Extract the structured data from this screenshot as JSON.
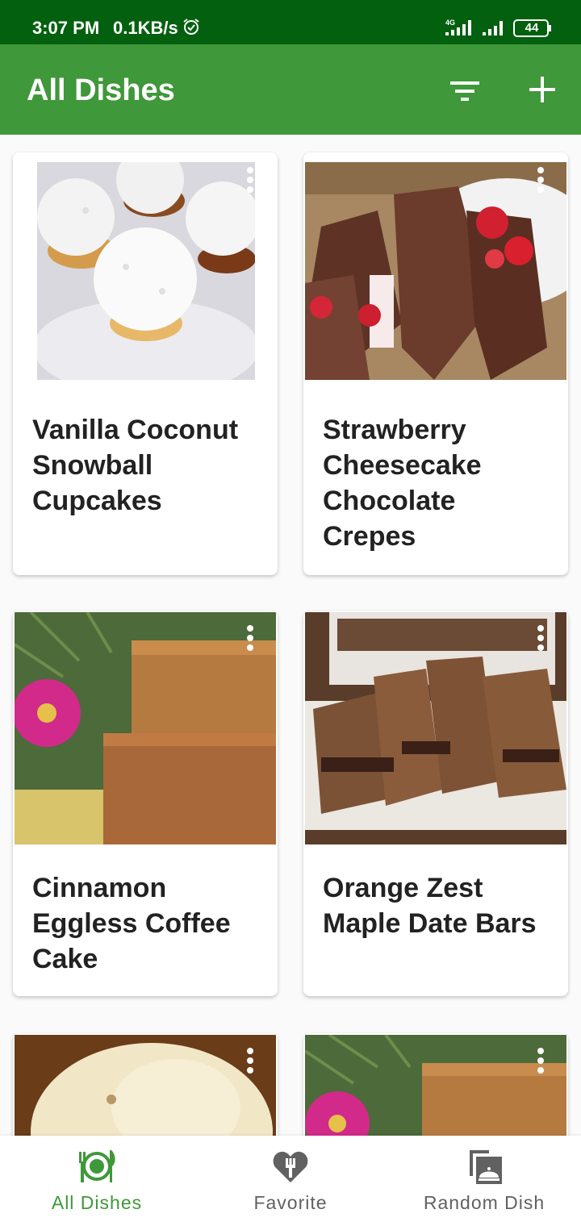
{
  "status_bar": {
    "time": "3:07 PM",
    "speed": "0.1KB/s",
    "network": "4G",
    "battery": "44"
  },
  "app_bar": {
    "title": "All Dishes",
    "filter_icon": "filter-icon",
    "add_icon": "add-icon"
  },
  "dishes": [
    {
      "title": "Vanilla Coconut Snowball Cupcakes",
      "image": "coconut-cupcakes-photo"
    },
    {
      "title": "Strawberry Cheesecake Chocolate Crepes",
      "image": "chocolate-crepes-photo"
    },
    {
      "title": "Cinnamon Eggless Coffee Cake",
      "image": "coffee-cake-photo"
    },
    {
      "title": "Orange Zest Maple Date Bars",
      "image": "date-bars-photo"
    },
    {
      "title": "",
      "image": "cream-dessert-photo"
    },
    {
      "title": "",
      "image": "coffee-cake-photo"
    }
  ],
  "bottom_nav": {
    "items": [
      {
        "label": "All Dishes",
        "icon": "plate-icon",
        "active": true
      },
      {
        "label": "Favorite",
        "icon": "heart-fork-icon",
        "active": false
      },
      {
        "label": "Random Dish",
        "icon": "cloche-icon",
        "active": false
      }
    ]
  },
  "colors": {
    "status_bar": "#03600f",
    "app_bar": "#3f9839",
    "nav_active": "#3f9839",
    "nav_inactive": "#616161"
  }
}
